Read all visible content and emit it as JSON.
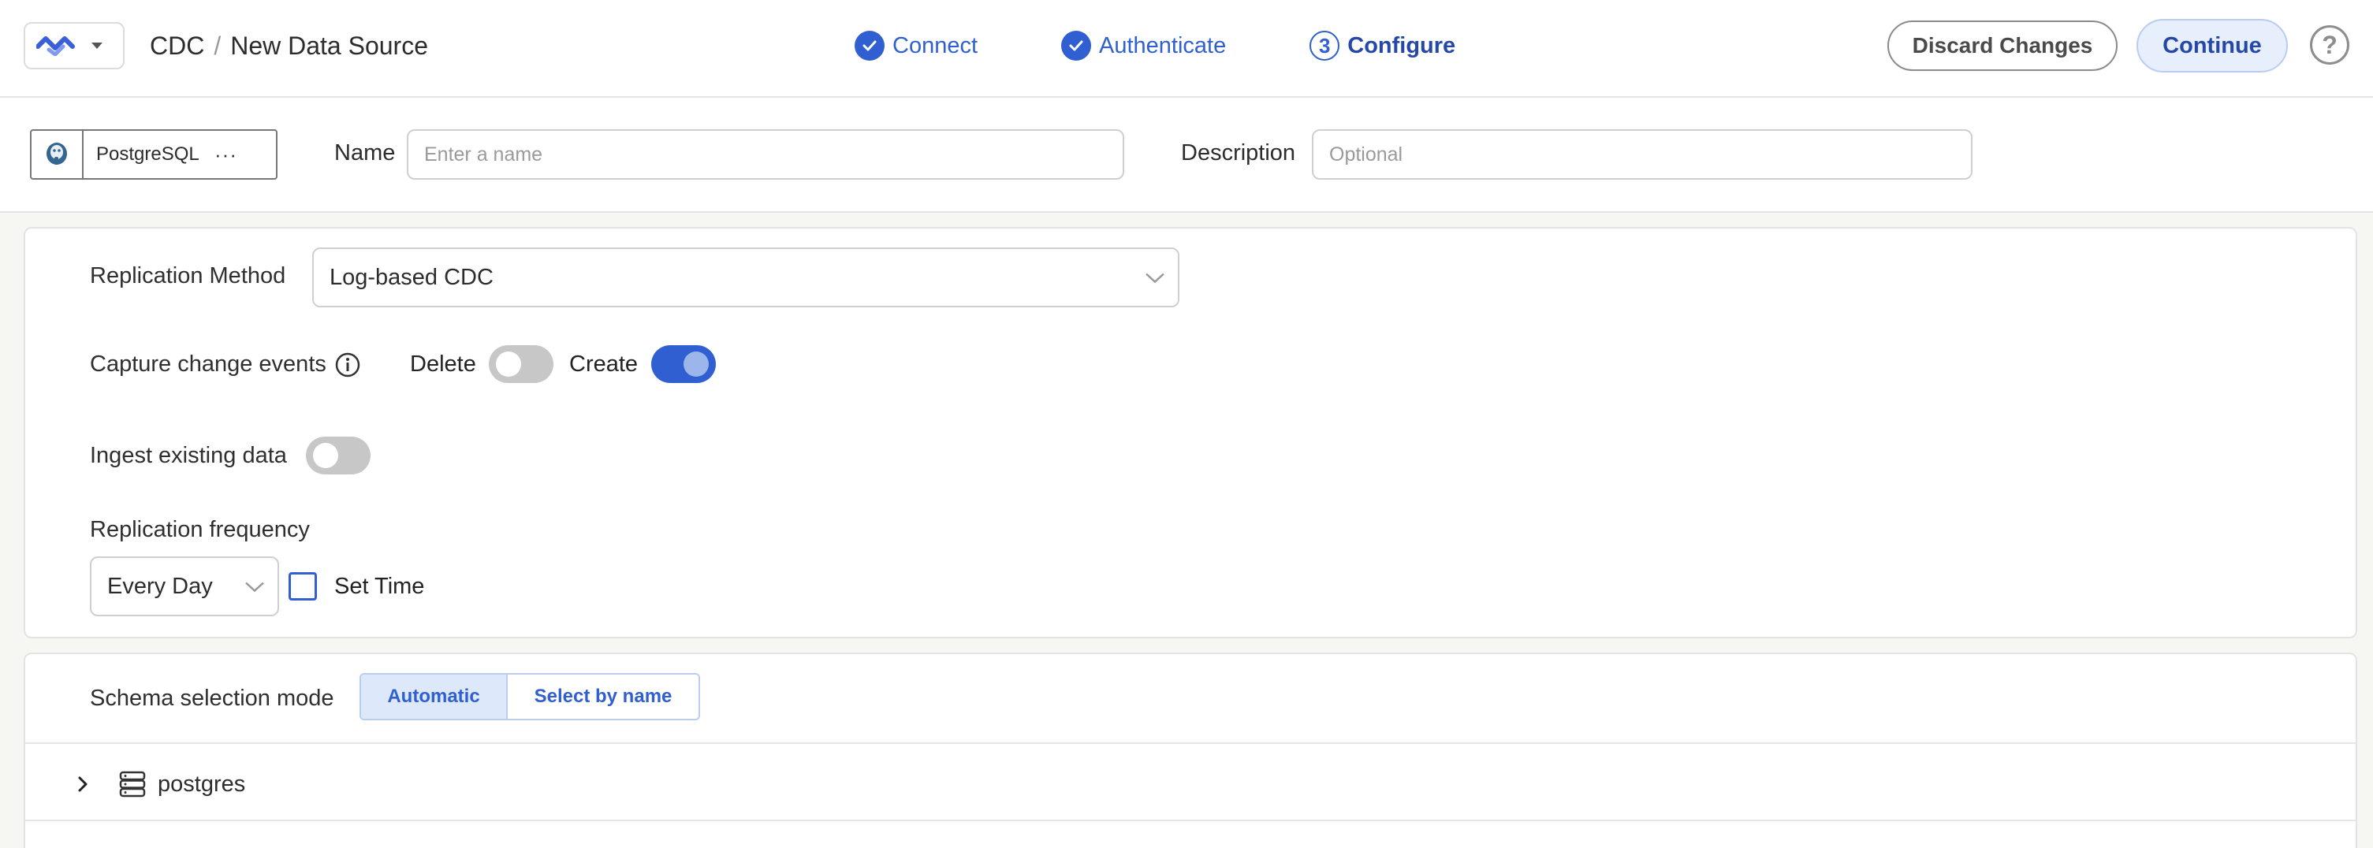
{
  "header": {
    "breadcrumb_root": "CDC",
    "breadcrumb_sep": "/",
    "breadcrumb_page": "New Data Source",
    "steps": [
      {
        "label": "Connect",
        "state": "done"
      },
      {
        "label": "Authenticate",
        "state": "done"
      },
      {
        "label": "Configure",
        "number": "3",
        "state": "active"
      }
    ],
    "discard_label": "Discard Changes",
    "continue_label": "Continue",
    "help_glyph": "?"
  },
  "source": {
    "connector_name": "PostgreSQL",
    "more_glyph": "···",
    "name_label": "Name",
    "name_placeholder": "Enter a name",
    "name_value": "",
    "description_label": "Description",
    "description_placeholder": "Optional",
    "description_value": ""
  },
  "config": {
    "replication_method_label": "Replication Method",
    "replication_method_value": "Log-based CDC",
    "capture_label": "Capture change events",
    "delete_label": "Delete",
    "delete_on": false,
    "create_label": "Create",
    "create_on": true,
    "ingest_label": "Ingest existing data",
    "ingest_on": false,
    "frequency_label": "Replication frequency",
    "frequency_value": "Every Day",
    "set_time_label": "Set Time",
    "set_time_checked": false
  },
  "schema": {
    "mode_label": "Schema selection mode",
    "options": [
      "Automatic",
      "Select by name"
    ],
    "selected": "Automatic",
    "databases": [
      {
        "name": "postgres",
        "expanded": false
      }
    ]
  },
  "colors": {
    "accent": "#2f5fd0",
    "accent_light": "#e7effd",
    "toggle_off": "#c7c7c7"
  }
}
